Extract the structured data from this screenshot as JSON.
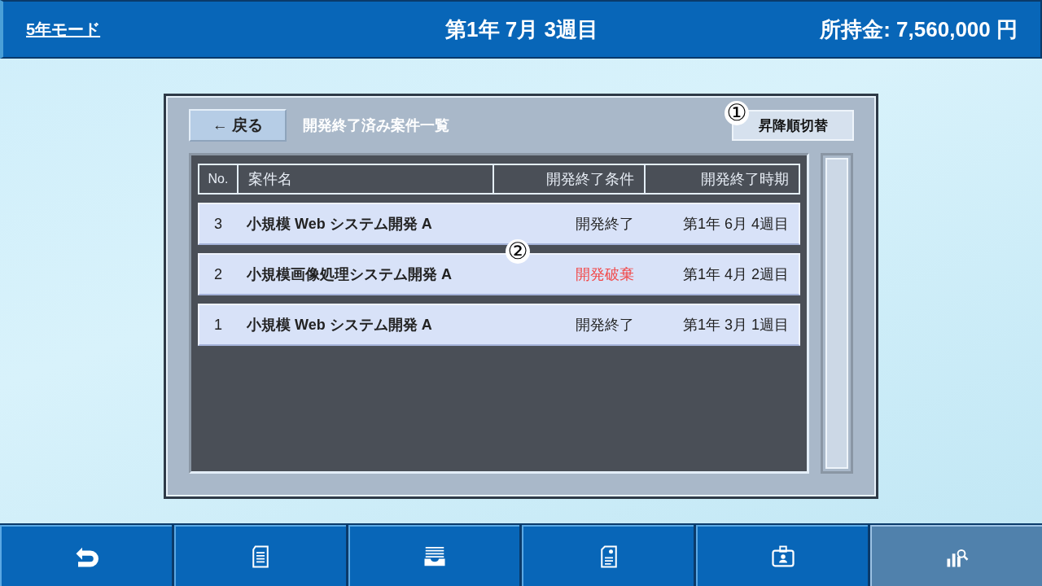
{
  "header": {
    "mode_link": "5年モード",
    "date": "第1年 7月 3週目",
    "money": "所持金: 7,560,000 円"
  },
  "panel": {
    "back_button": "← 戻る",
    "title": "開発終了済み案件一覧",
    "sort_button": "昇降順切替",
    "callouts": [
      "①",
      "②"
    ],
    "table": {
      "columns": [
        "No.",
        "案件名",
        "開発終了条件",
        "開発終了時期"
      ],
      "rows": [
        {
          "no": "3",
          "name": "小規模 Web システム開発 A",
          "condition": "開発終了",
          "color": "#222222",
          "period": "第1年 6月 4週目"
        },
        {
          "no": "2",
          "name": "小規模画像処理システム開発 A",
          "condition": "開発破棄",
          "color": "#f24848",
          "period": "第1年 4月 2週目"
        },
        {
          "no": "1",
          "name": "小規模 Web システム開発 A",
          "condition": "開発終了",
          "color": "#222222",
          "period": "第1年 3月 1週目"
        }
      ]
    }
  },
  "nav": [
    {
      "kind": "back",
      "selected": false
    },
    {
      "kind": "document",
      "selected": false
    },
    {
      "kind": "tray",
      "selected": false
    },
    {
      "kind": "profile-doc",
      "selected": false
    },
    {
      "kind": "id-card",
      "selected": false
    },
    {
      "kind": "chart-search",
      "selected": true
    }
  ]
}
